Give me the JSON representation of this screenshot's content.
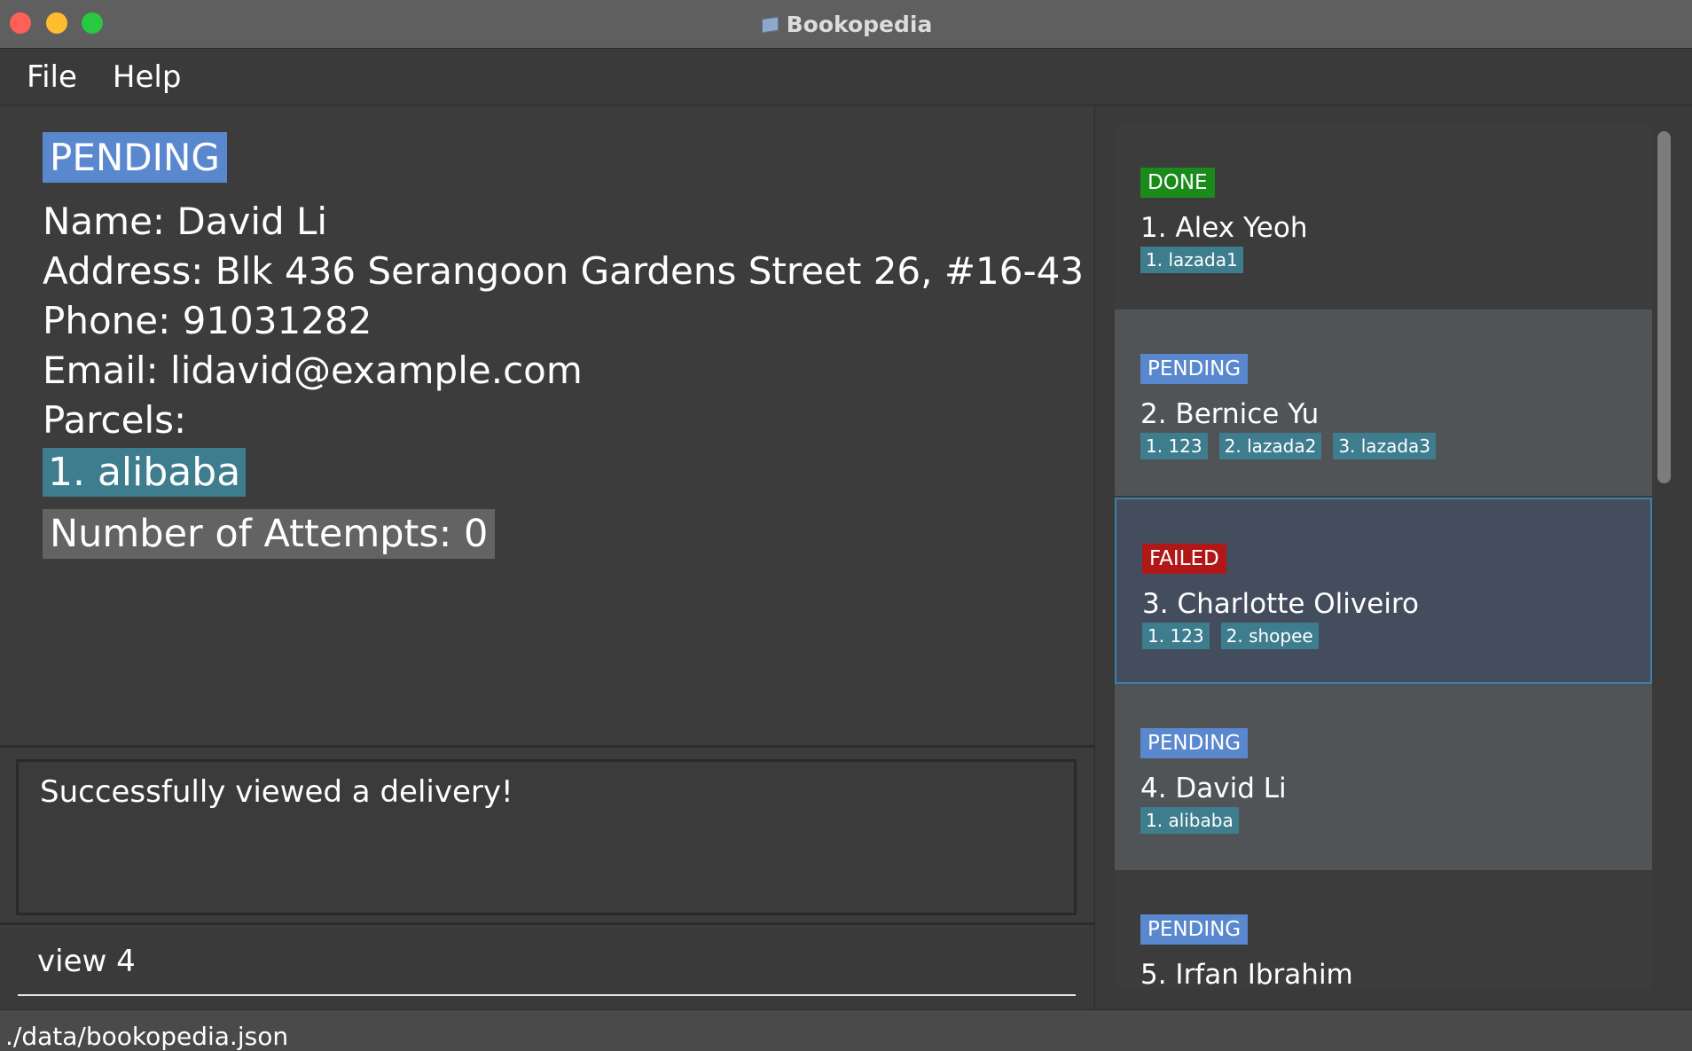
{
  "window": {
    "title": "Bookopedia"
  },
  "menu": {
    "file": "File",
    "help": "Help"
  },
  "detail": {
    "status": "PENDING",
    "name": "Name: David Li",
    "address": "Address: Blk 436 Serangoon Gardens Street 26, #16-43",
    "phone": "Phone: 91031282",
    "email": "Email: lidavid@example.com",
    "parcels_label": "Parcels:",
    "parcel": "1. alibaba",
    "attempts": "Number of Attempts: 0"
  },
  "result": {
    "message": "Successfully viewed a delivery!"
  },
  "command": {
    "value": "view 4"
  },
  "statusbar": {
    "path": "./data/bookopedia.json"
  },
  "deliveries": [
    {
      "status": "DONE",
      "name": "1.  Alex Yeoh",
      "parcels": [
        "1. lazada1"
      ]
    },
    {
      "status": "PENDING",
      "name": "2.  Bernice Yu",
      "parcels": [
        "1. 123",
        "2. lazada2",
        "3. lazada3"
      ]
    },
    {
      "status": "FAILED",
      "name": "3.  Charlotte Oliveiro",
      "parcels": [
        "1. 123",
        "2. shopee"
      ]
    },
    {
      "status": "PENDING",
      "name": "4.  David Li",
      "parcels": [
        "1. alibaba"
      ]
    },
    {
      "status": "PENDING",
      "name": "5.  Irfan Ibrahim",
      "parcels": []
    }
  ],
  "colors": {
    "done": "#1a8a1a",
    "pending": "#5a88cf",
    "failed": "#b01818",
    "tag": "#3d7d8e",
    "selected_border": "#3e7fa8"
  }
}
